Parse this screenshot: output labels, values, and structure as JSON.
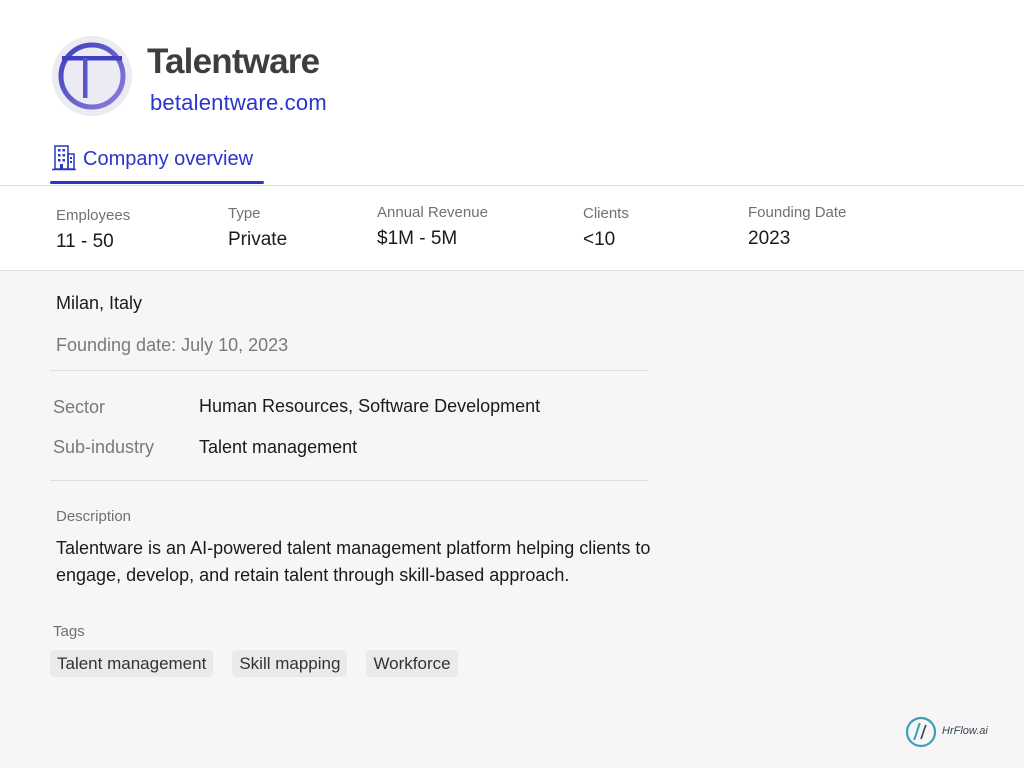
{
  "company": {
    "name": "Talentware",
    "website": "betalentware.com",
    "logo_letter": "T"
  },
  "tabs": {
    "overview_label": "Company overview"
  },
  "stats": [
    {
      "label": "Employees",
      "value": "11 - 50"
    },
    {
      "label": "Type",
      "value": "Private"
    },
    {
      "label": "Annual Revenue",
      "value": "$1M - 5M"
    },
    {
      "label": "Clients",
      "value": "<10"
    },
    {
      "label": "Founding Date",
      "value": "2023"
    }
  ],
  "details": {
    "location": "Milan, Italy",
    "founding_date_line": "Founding date: July 10, 2023",
    "sector_label": "Sector",
    "sector_value": "Human Resources, Software Development",
    "subindustry_label": "Sub-industry",
    "subindustry_value": "Talent management"
  },
  "description": {
    "label": "Description",
    "text": "Talentware is an AI-powered talent management platform helping clients to engage, develop, and retain talent through skill-based approach."
  },
  "tags": {
    "label": "Tags",
    "items": [
      "Talent management",
      "Skill mapping",
      "Workforce"
    ]
  },
  "brand": {
    "name": "HrFlow.ai"
  },
  "colors": {
    "accent": "#2a35c9",
    "logo_ring": "#5553c7",
    "panel_bg": "#f7f5f6",
    "brand_teal": "#3aa0b8"
  },
  "icons": {
    "tab_icon": "building-icon",
    "logo_icon": "company-logo",
    "brand_icon": "hrflow-logo-icon"
  }
}
